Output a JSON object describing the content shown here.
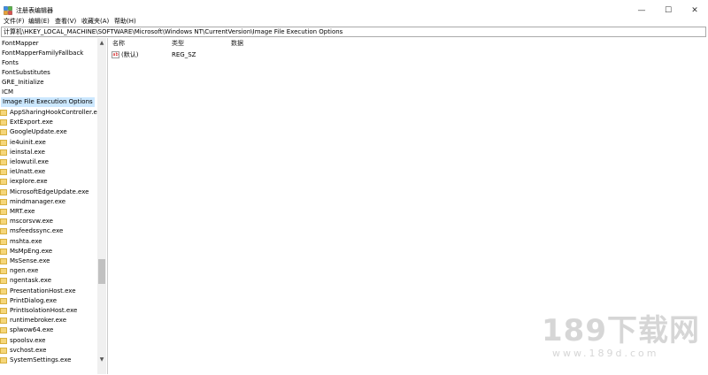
{
  "window": {
    "title": "注册表编辑器",
    "controls": {
      "minimize": "—",
      "maximize": "☐",
      "close": "✕"
    }
  },
  "menu": [
    "文件(F)",
    "编辑(E)",
    "查看(V)",
    "收藏夹(A)",
    "帮助(H)"
  ],
  "address": "计算机\\HKEY_LOCAL_MACHINE\\SOFTWARE\\Microsoft\\Windows NT\\CurrentVersion\\Image File Execution Options",
  "tree": {
    "top_items": [
      "FontMapper",
      "FontMapperFamilyFallback",
      "Fonts",
      "FontSubstitutes",
      "GRE_Initialize",
      "ICM"
    ],
    "selected": "Image File Execution Options",
    "children": [
      "AppSharingHookController.exe",
      "ExtExport.exe",
      "GoogleUpdate.exe",
      "ie4uinit.exe",
      "ieinstal.exe",
      "ielowutil.exe",
      "ieUnatt.exe",
      "iexplore.exe",
      "MicrosoftEdgeUpdate.exe",
      "mindmanager.exe",
      "MRT.exe",
      "mscorsvw.exe",
      "msfeedssync.exe",
      "mshta.exe",
      "MsMpEng.exe",
      "MsSense.exe",
      "ngen.exe",
      "ngentask.exe",
      "PresentationHost.exe",
      "PrintDialog.exe",
      "PrintIsolationHost.exe",
      "runtimebroker.exe",
      "splwow64.exe",
      "spoolsv.exe",
      "svchost.exe",
      "SystemSettings.exe"
    ]
  },
  "values_pane": {
    "headers": {
      "name": "名称",
      "type": "类型",
      "data": "数据"
    },
    "rows": [
      {
        "icon": "ab",
        "name": "(默认)",
        "type": "REG_SZ",
        "data": ""
      }
    ]
  },
  "watermark": {
    "main": "189下载网",
    "url": "www.189d.com"
  }
}
